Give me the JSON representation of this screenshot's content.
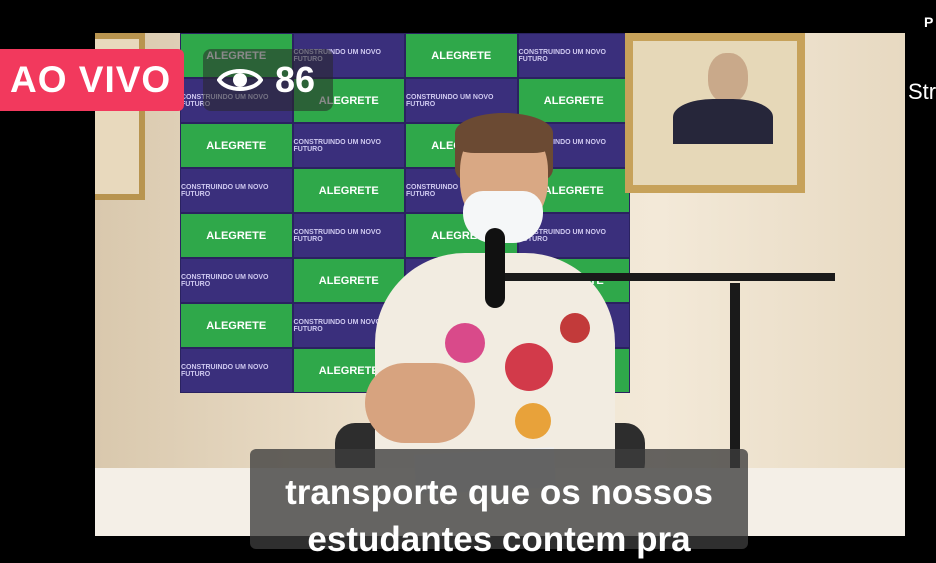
{
  "stream": {
    "live_label": "AO VIVO",
    "viewer_count": "86",
    "top_right_text": "P",
    "side_text": "Str"
  },
  "backdrop": {
    "brand": "ALEGRETE",
    "slogan": "CONSTRUINDO UM NOVO FUTURO"
  },
  "caption": {
    "line1": "transporte que os nossos",
    "line2": "estudantes contem pra"
  },
  "colors": {
    "live_badge": "#f2395d",
    "backdrop_purple": "#3a2f7c",
    "backdrop_green": "#2fa84a"
  },
  "icons": {
    "viewers": "eye-icon"
  }
}
